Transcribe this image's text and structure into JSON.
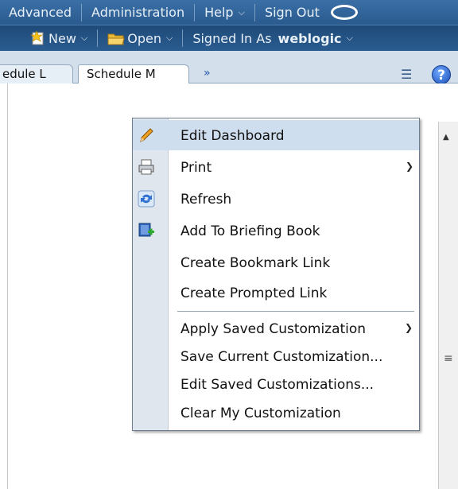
{
  "nav": {
    "advanced": "Advanced",
    "administration": "Administration",
    "help": "Help",
    "sign_out": "Sign Out",
    "new": "New",
    "open": "Open",
    "signed_in_as": "Signed In As",
    "username": "weblogic"
  },
  "tabs": [
    {
      "label": "edule L"
    },
    {
      "label": "Schedule M"
    }
  ],
  "tab_more": "»",
  "menu": {
    "items": [
      {
        "label": "Edit Dashboard",
        "icon": "pencil-icon"
      },
      {
        "label": "Print",
        "icon": "printer-icon",
        "submenu": true
      },
      {
        "label": "Refresh",
        "icon": "refresh-icon"
      },
      {
        "label": "Add To Briefing Book",
        "icon": "briefing-book-add-icon"
      },
      {
        "label": "Create Bookmark Link"
      },
      {
        "label": "Create Prompted Link"
      },
      {
        "label": "Apply Saved Customization",
        "submenu": true
      },
      {
        "label": "Save Current Customization..."
      },
      {
        "label": "Edit Saved Customizations..."
      },
      {
        "label": "Clear My Customization"
      }
    ]
  },
  "colors": {
    "nav_bg": "#2a5a8e",
    "menu_highlight": "#cfdeee",
    "menu_gutter": "#dfe6ee"
  }
}
